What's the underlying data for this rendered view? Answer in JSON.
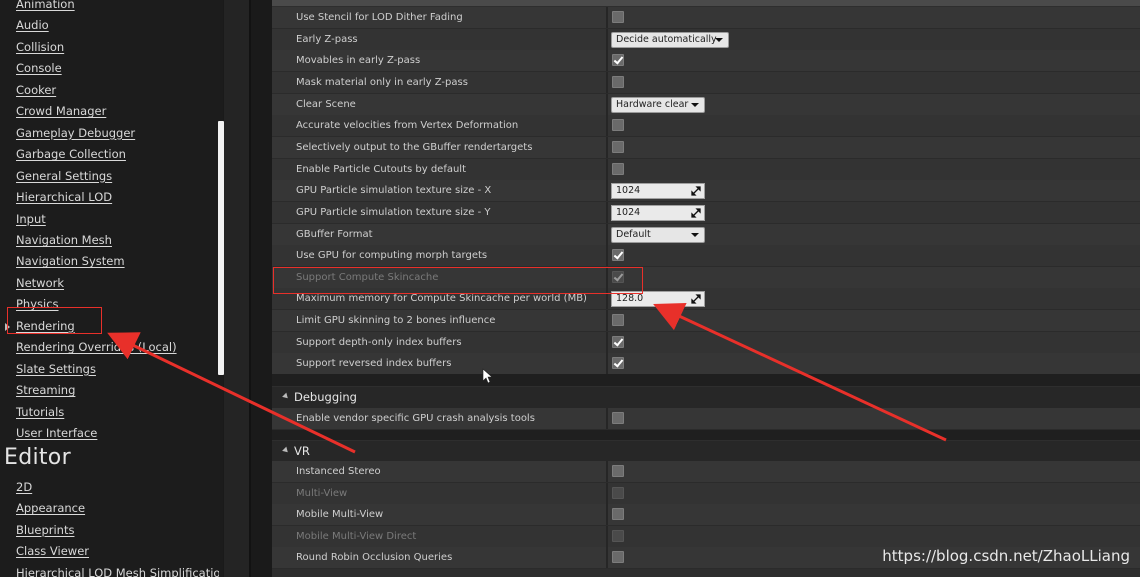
{
  "nav": {
    "items": [
      "Animation",
      "Audio",
      "Collision",
      "Console",
      "Cooker",
      "Crowd Manager",
      "Gameplay Debugger",
      "Garbage Collection",
      "General Settings",
      "Hierarchical LOD",
      "Input",
      "Navigation Mesh",
      "Navigation System",
      "Network",
      "Physics",
      "Rendering",
      "Rendering Overrides (Local)",
      "Slate Settings",
      "Streaming",
      "Tutorials",
      "User Interface"
    ],
    "selected": "Rendering",
    "section_editor": "Editor",
    "editor_items": [
      "2D",
      "Appearance",
      "Blueprints",
      "Class Viewer",
      "Hierarchical LOD Mesh Simplification"
    ]
  },
  "rendering_rows": [
    {
      "label": "Use Stencil for LOD Dither Fading",
      "type": "checkbox",
      "checked": false
    },
    {
      "label": "Early Z-pass",
      "type": "dropdown",
      "value": "Decide automatically"
    },
    {
      "label": "Movables in early Z-pass",
      "type": "checkbox",
      "checked": true
    },
    {
      "label": "Mask material only in early Z-pass",
      "type": "checkbox",
      "checked": false
    },
    {
      "label": "Clear Scene",
      "type": "dropdown",
      "value": "Hardware clear"
    },
    {
      "label": "Accurate velocities from Vertex Deformation",
      "type": "checkbox",
      "checked": false
    },
    {
      "label": "Selectively output to the GBuffer rendertargets",
      "type": "checkbox",
      "checked": false
    },
    {
      "label": "Enable Particle Cutouts by default",
      "type": "checkbox",
      "checked": false
    },
    {
      "label": "GPU Particle simulation texture size - X",
      "type": "number",
      "value": "1024"
    },
    {
      "label": "GPU Particle simulation texture size - Y",
      "type": "number",
      "value": "1024"
    },
    {
      "label": "GBuffer Format",
      "type": "dropdown",
      "value": "Default"
    },
    {
      "label": "Use GPU for computing morph targets",
      "type": "checkbox",
      "checked": true
    },
    {
      "label": "Support Compute Skincache",
      "type": "checkbox",
      "checked": true,
      "disabled": true
    },
    {
      "label": "Maximum memory for Compute Skincache per world (MB)",
      "type": "number",
      "value": "128.0"
    },
    {
      "label": "Limit GPU skinning to 2 bones influence",
      "type": "checkbox",
      "checked": false
    },
    {
      "label": "Support depth-only index buffers",
      "type": "checkbox",
      "checked": true
    },
    {
      "label": "Support reversed index buffers",
      "type": "checkbox",
      "checked": true
    }
  ],
  "debugging": {
    "title": "Debugging",
    "rows": [
      {
        "label": "Enable vendor specific GPU crash analysis tools",
        "type": "checkbox",
        "checked": false
      }
    ]
  },
  "vr": {
    "title": "VR",
    "rows": [
      {
        "label": "Instanced Stereo",
        "type": "checkbox",
        "checked": false
      },
      {
        "label": "Multi-View",
        "type": "checkbox",
        "checked": false,
        "disabled": true
      },
      {
        "label": "Mobile Multi-View",
        "type": "checkbox",
        "checked": false
      },
      {
        "label": "Mobile Multi-View Direct",
        "type": "checkbox",
        "checked": false,
        "disabled": true
      },
      {
        "label": "Round Robin Occlusion Queries",
        "type": "checkbox",
        "checked": false
      }
    ]
  },
  "watermark": "https://blog.csdn.net/ZhaoLLiang",
  "colors": {
    "annotation": "#e8302a"
  }
}
